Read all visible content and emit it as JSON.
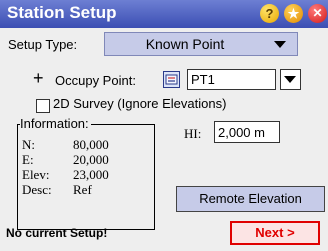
{
  "window": {
    "title": "Station Setup",
    "help_glyph": "?",
    "close_glyph": "✕"
  },
  "setup_type": {
    "label": "Setup Type:",
    "value": "Known Point"
  },
  "occupy": {
    "plus": "+",
    "label": "Occupy Point:",
    "value": "PT1"
  },
  "survey_2d": {
    "label": "2D Survey (Ignore Elevations)",
    "checked": false
  },
  "information": {
    "title": "Information:",
    "rows": [
      {
        "key": "N:",
        "value": "80,000"
      },
      {
        "key": "E:",
        "value": "20,000"
      },
      {
        "key": "Elev:",
        "value": "23,000"
      },
      {
        "key": "Desc:",
        "value": "Ref"
      }
    ]
  },
  "hi": {
    "label": "HI:",
    "value": "2,000 m"
  },
  "remote_elevation_label": "Remote Elevation",
  "status": "No current Setup!",
  "next_label": "Next >",
  "colors": {
    "titlebar": "#4b5fc4",
    "combo": "#c6cbe8",
    "next_border": "#e00000"
  },
  "icons": [
    "help-icon",
    "star-icon",
    "close-icon",
    "dropdown-arrow-icon",
    "point-pick-icon"
  ]
}
